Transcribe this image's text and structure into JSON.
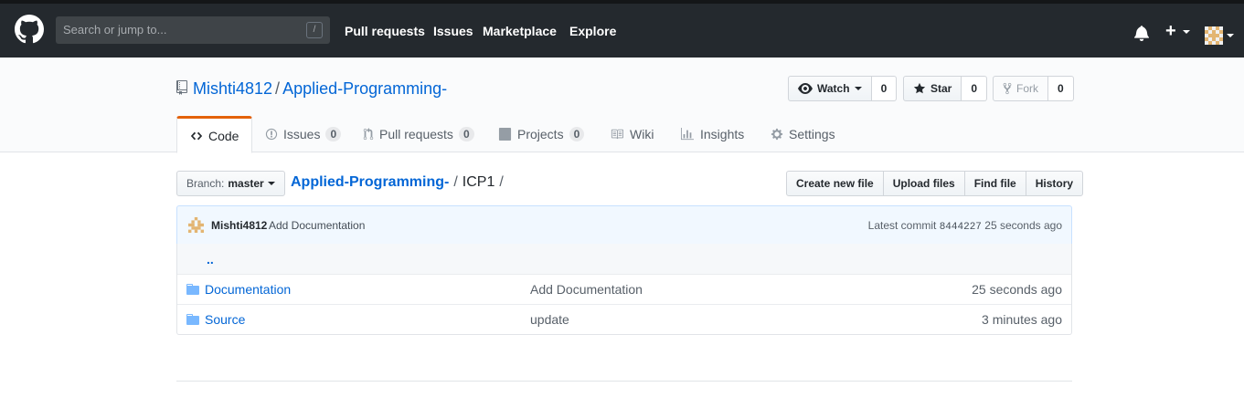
{
  "topbar": {
    "search_placeholder": "Search or jump to...",
    "search_shortcut": "/",
    "nav": [
      "Pull requests",
      "Issues",
      "Marketplace",
      "Explore"
    ],
    "plus": "+"
  },
  "repo": {
    "owner": "Mishti4812",
    "separator": "/",
    "name": "Applied-Programming-",
    "watch_label": "Watch",
    "watch_count": "0",
    "star_label": "Star",
    "star_count": "0",
    "fork_label": "Fork",
    "fork_count": "0"
  },
  "tabs": [
    {
      "label": "Code",
      "icon": "code-icon",
      "selected": true
    },
    {
      "label": "Issues",
      "count": "0",
      "icon": "issue-icon"
    },
    {
      "label": "Pull requests",
      "count": "0",
      "icon": "pull-request-icon"
    },
    {
      "label": "Projects",
      "count": "0",
      "icon": "project-icon"
    },
    {
      "label": "Wiki",
      "icon": "book-icon"
    },
    {
      "label": "Insights",
      "icon": "graph-icon"
    },
    {
      "label": "Settings",
      "icon": "gear-icon"
    }
  ],
  "filenav": {
    "branch_prefix": "Branch:",
    "branch": "master",
    "breadcrumb_root": "Applied-Programming-",
    "breadcrumb_sep": "/",
    "breadcrumb_dir": "ICP1",
    "buttons": [
      "Create new file",
      "Upload files",
      "Find file",
      "History"
    ]
  },
  "commit": {
    "author": "Mishti4812",
    "message": "Add Documentation",
    "latest_label": "Latest commit",
    "sha": "8444227",
    "age": "25 seconds ago"
  },
  "files": {
    "up": "..",
    "rows": [
      {
        "name": "Documentation",
        "message": "Add Documentation",
        "age": "25 seconds ago",
        "icon": "folder-icon"
      },
      {
        "name": "Source",
        "message": "update",
        "age": "3 minutes ago",
        "icon": "folder-icon"
      }
    ]
  },
  "colors": {
    "header_bg": "#24292e",
    "link": "#0366d6",
    "tab_accent": "#e36209",
    "commit_bg": "#f1f8ff"
  }
}
